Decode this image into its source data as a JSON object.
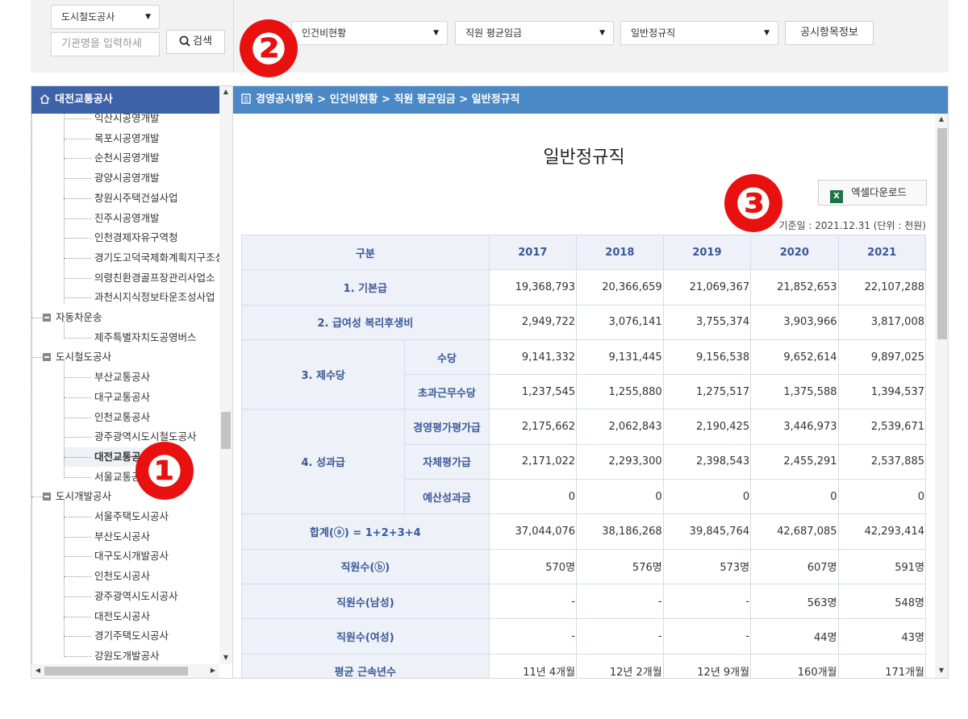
{
  "search": {
    "category": "도시철도공사",
    "placeholder": "기관명을 입력하세",
    "button": "검색"
  },
  "filters": {
    "first": "인건비현황",
    "second": "직원 평균임금",
    "third": "일반정규직",
    "info_button": "공시항목정보"
  },
  "markers": [
    "❷",
    "❸",
    "❶"
  ],
  "tree": {
    "header": "대전교통공사",
    "items": [
      {
        "label": "익산시공영개발",
        "type": "leaf"
      },
      {
        "label": "목포시공영개발",
        "type": "leaf"
      },
      {
        "label": "순천시공영개발",
        "type": "leaf"
      },
      {
        "label": "광양시공영개발",
        "type": "leaf"
      },
      {
        "label": "창원시주택건설사업",
        "type": "leaf"
      },
      {
        "label": "진주시공영개발",
        "type": "leaf"
      },
      {
        "label": "인천경제자유구역청",
        "type": "leaf"
      },
      {
        "label": "경기도고덕국제화계획지구조성사",
        "type": "leaf"
      },
      {
        "label": "의령친환경골프장관리사업소",
        "type": "leaf"
      },
      {
        "label": "과천시지식정보타운조성사업",
        "type": "leaf"
      },
      {
        "label": "자동차운송",
        "type": "group"
      },
      {
        "label": "제주특별자치도공영버스",
        "type": "leaf"
      },
      {
        "label": "도시철도공사",
        "type": "group"
      },
      {
        "label": "부산교통공사",
        "type": "leaf"
      },
      {
        "label": "대구교통공사",
        "type": "leaf"
      },
      {
        "label": "인천교통공사",
        "type": "leaf"
      },
      {
        "label": "광주광역시도시철도공사",
        "type": "leaf"
      },
      {
        "label": "대전교통공사",
        "type": "leaf",
        "selected": true
      },
      {
        "label": "서울교통공사",
        "type": "leaf"
      },
      {
        "label": "도시개발공사",
        "type": "group"
      },
      {
        "label": "서울주택도시공사",
        "type": "leaf"
      },
      {
        "label": "부산도시공사",
        "type": "leaf"
      },
      {
        "label": "대구도시개발공사",
        "type": "leaf"
      },
      {
        "label": "인천도시공사",
        "type": "leaf"
      },
      {
        "label": "광주광역시도시공사",
        "type": "leaf"
      },
      {
        "label": "대전도시공사",
        "type": "leaf"
      },
      {
        "label": "경기주택도시공사",
        "type": "leaf"
      },
      {
        "label": "강원도개발공사",
        "type": "leaf"
      }
    ]
  },
  "content": {
    "breadcrumb": "경영공시항목 > 인건비현황 > 직원 평균임금 > 일반정규직",
    "title": "일반정규직",
    "excel_button": "엑셀다운로드",
    "basis": "기준일 : 2021.12.31 (단위 : 천원)",
    "table": {
      "corner": "구분",
      "years": [
        "2017",
        "2018",
        "2019",
        "2020",
        "2021"
      ],
      "rows": [
        {
          "group": "1. 기본급",
          "values": [
            "19,368,793",
            "20,366,659",
            "21,069,367",
            "21,852,653",
            "22,107,288"
          ]
        },
        {
          "group": "2. 급여성 복리후생비",
          "values": [
            "2,949,722",
            "3,076,141",
            "3,755,374",
            "3,903,966",
            "3,817,008"
          ]
        },
        {
          "group": "3. 제수당",
          "sub": "수당",
          "values": [
            "9,141,332",
            "9,131,445",
            "9,156,538",
            "9,652,614",
            "9,897,025"
          ]
        },
        {
          "sub": "초과근무수당",
          "values": [
            "1,237,545",
            "1,255,880",
            "1,275,517",
            "1,375,588",
            "1,394,537"
          ]
        },
        {
          "group": "4. 성과급",
          "sub": "경영평가평가급",
          "values": [
            "2,175,662",
            "2,062,843",
            "2,190,425",
            "3,446,973",
            "2,539,671"
          ]
        },
        {
          "sub": "자체평가급",
          "values": [
            "2,171,022",
            "2,293,300",
            "2,398,543",
            "2,455,291",
            "2,537,885"
          ]
        },
        {
          "sub": "예산성과금",
          "values": [
            "0",
            "0",
            "0",
            "0",
            "0"
          ]
        },
        {
          "group": "합계(ⓐ) = 1+2+3+4",
          "values": [
            "37,044,076",
            "38,186,268",
            "39,845,764",
            "42,687,085",
            "42,293,414"
          ]
        },
        {
          "group": "직원수(ⓑ)",
          "values": [
            "570명",
            "576명",
            "573명",
            "607명",
            "591명"
          ]
        },
        {
          "group": "직원수(남성)",
          "values": [
            "-",
            "-",
            "-",
            "563명",
            "548명"
          ]
        },
        {
          "group": "직원수(여성)",
          "values": [
            "-",
            "-",
            "-",
            "44명",
            "43명"
          ]
        },
        {
          "group": "평균 근속년수",
          "values": [
            "11년 4개월",
            "12년 2개월",
            "12년 9개월",
            "160개월",
            "171개월"
          ]
        }
      ]
    }
  }
}
